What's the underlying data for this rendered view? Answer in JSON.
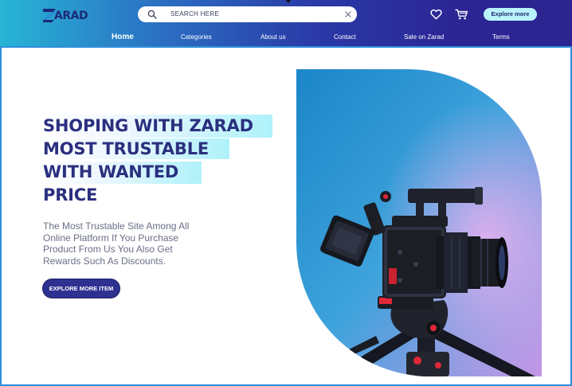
{
  "header": {
    "logo": {
      "text": "ARAD",
      "brand": "ZARAD"
    },
    "search": {
      "placeholder": "SEARCH HERE"
    },
    "explore_label": "Explore more",
    "icons": {
      "search": "search-icon",
      "clear": "close-icon",
      "wishlist": "heart-icon",
      "cart": "cart-icon"
    },
    "colors": {
      "gradient_start": "#27b5d6",
      "gradient_end": "#2c248f",
      "explore_bg": "#b9f3fb"
    }
  },
  "nav": {
    "items": [
      {
        "label": "Home",
        "active": true
      },
      {
        "label": "Categories",
        "active": false
      },
      {
        "label": "About us",
        "active": false
      },
      {
        "label": "Contact",
        "active": false
      },
      {
        "label": "Sale on Zarad",
        "active": false
      },
      {
        "label": "Terms",
        "active": false
      }
    ]
  },
  "hero": {
    "title_lines": [
      "SHOPING WITH ZARAD",
      "MOST TRUSTABLE",
      "WITH WANTED",
      "PRICE"
    ],
    "description_lines": [
      "The Most Trustable Site Among All",
      "Online Platform If You Purchase",
      "Product From Us You Also Get",
      "Rewards Such As Discounts."
    ],
    "cta_label": "EXPLORE MORE ITEM",
    "image": "camera-on-tripod",
    "colors": {
      "title": "#2b2f7f",
      "highlight": "#aff2fa",
      "cta_bg": "#2f3191"
    }
  }
}
